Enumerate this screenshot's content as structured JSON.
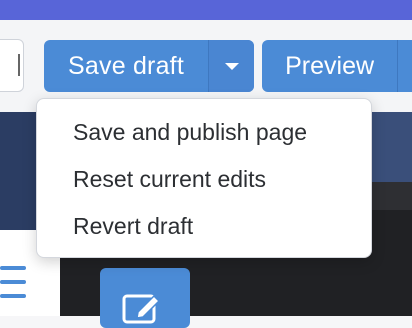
{
  "toolbar": {
    "save_label": "Save draft",
    "preview_label": "Preview"
  },
  "dropdown": {
    "items": [
      {
        "label": "Save and publish page"
      },
      {
        "label": "Reset current edits"
      },
      {
        "label": "Revert draft"
      }
    ]
  },
  "icons": {
    "save_toggle": "chevron-down-icon",
    "menu": "hamburger-icon",
    "edit": "pencil-edit-icon"
  },
  "colors": {
    "accent": "#4b8bd6",
    "top_strip": "#5865d8",
    "sidebar_dark": "#2b3d63",
    "content_dark": "#202124"
  }
}
